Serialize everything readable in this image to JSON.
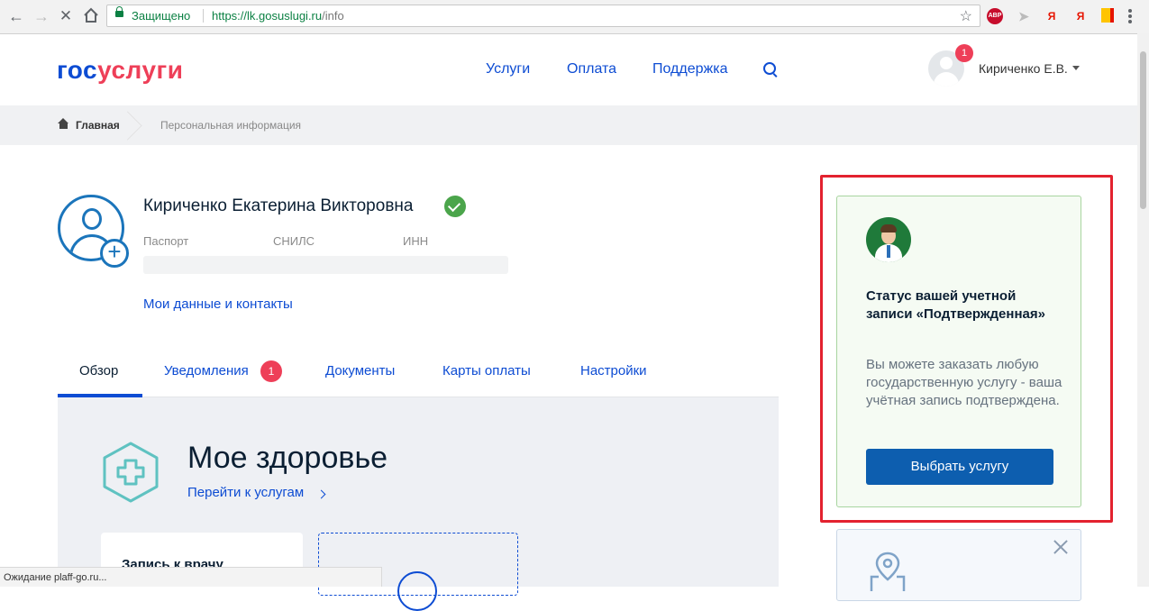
{
  "browser": {
    "secure_label": "Защищено",
    "url_host": "https://lk.gosuslugi.ru",
    "url_path": "/info",
    "extensions": [
      "ABP",
      "Я",
      "Я"
    ]
  },
  "header": {
    "logo_part1": "гос",
    "logo_part2": "услуги",
    "nav": [
      "Услуги",
      "Оплата",
      "Поддержка"
    ],
    "notification_count": "1",
    "user_name": "Кириченко Е.В."
  },
  "breadcrumb": {
    "home": "Главная",
    "current": "Персональная информация"
  },
  "profile": {
    "full_name": "Кириченко Екатерина Викторовна",
    "doc_labels": [
      "Паспорт",
      "СНИЛС",
      "ИНН"
    ],
    "my_data_link": "Мои данные и контакты"
  },
  "tabs": [
    {
      "label": "Обзор",
      "active": true
    },
    {
      "label": "Уведомления",
      "badge": "1"
    },
    {
      "label": "Документы"
    },
    {
      "label": "Карты оплаты"
    },
    {
      "label": "Настройки"
    }
  ],
  "health": {
    "title": "Мое здоровье",
    "link": "Перейти к услугам",
    "card_title": "Запись к врачу"
  },
  "status_card": {
    "title": "Статус вашей учетной записи «Подтвержденная»",
    "text": "Вы можете заказать любую государственную услугу - ваша учётная запись подтверждена.",
    "button": "Выбрать услугу"
  },
  "statusbar": {
    "text": "Ожидание plaff-go.ru..."
  },
  "colors": {
    "accent": "#0d4cd3",
    "logo_red": "#ee3f58",
    "highlight": "#e3222f",
    "verified": "#4ba54b",
    "button": "#0d5eaf"
  }
}
